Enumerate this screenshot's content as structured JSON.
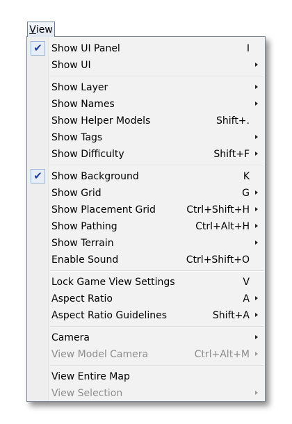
{
  "menu_bar": {
    "mnemonic": "V",
    "rest": "iew"
  },
  "groups": [
    [
      {
        "label": "Show UI Panel",
        "shortcut": "I",
        "checked": true,
        "submenu": false,
        "disabled": false
      },
      {
        "label": "Show UI",
        "shortcut": "",
        "checked": false,
        "submenu": true,
        "disabled": false
      }
    ],
    [
      {
        "label": "Show Layer",
        "shortcut": "",
        "checked": false,
        "submenu": true,
        "disabled": false
      },
      {
        "label": "Show Names",
        "shortcut": "",
        "checked": false,
        "submenu": true,
        "disabled": false
      },
      {
        "label": "Show Helper Models",
        "shortcut": "Shift+.",
        "checked": false,
        "submenu": false,
        "disabled": false
      },
      {
        "label": "Show Tags",
        "shortcut": "",
        "checked": false,
        "submenu": true,
        "disabled": false
      },
      {
        "label": "Show Difficulty",
        "shortcut": "Shift+F",
        "checked": false,
        "submenu": true,
        "disabled": false
      }
    ],
    [
      {
        "label": "Show Background",
        "shortcut": "K",
        "checked": true,
        "submenu": false,
        "disabled": false
      },
      {
        "label": "Show Grid",
        "shortcut": "G",
        "checked": false,
        "submenu": true,
        "disabled": false
      },
      {
        "label": "Show Placement Grid",
        "shortcut": "Ctrl+Shift+H",
        "checked": false,
        "submenu": true,
        "disabled": false
      },
      {
        "label": "Show Pathing",
        "shortcut": "Ctrl+Alt+H",
        "checked": false,
        "submenu": true,
        "disabled": false
      },
      {
        "label": "Show Terrain",
        "shortcut": "",
        "checked": false,
        "submenu": true,
        "disabled": false
      },
      {
        "label": "Enable Sound",
        "shortcut": "Ctrl+Shift+O",
        "checked": false,
        "submenu": false,
        "disabled": false
      }
    ],
    [
      {
        "label": "Lock Game View Settings",
        "shortcut": "V",
        "checked": false,
        "submenu": false,
        "disabled": false
      },
      {
        "label": "Aspect Ratio",
        "shortcut": "A",
        "checked": false,
        "submenu": true,
        "disabled": false
      },
      {
        "label": "Aspect Ratio Guidelines",
        "shortcut": "Shift+A",
        "checked": false,
        "submenu": true,
        "disabled": false
      }
    ],
    [
      {
        "label": "Camera",
        "shortcut": "",
        "checked": false,
        "submenu": true,
        "disabled": false
      },
      {
        "label": "View Model Camera",
        "shortcut": "Ctrl+Alt+M",
        "checked": false,
        "submenu": true,
        "disabled": true
      }
    ],
    [
      {
        "label": "View Entire Map",
        "shortcut": "",
        "checked": false,
        "submenu": false,
        "disabled": false
      },
      {
        "label": "View Selection",
        "shortcut": "",
        "checked": false,
        "submenu": true,
        "disabled": true
      }
    ]
  ],
  "icons": {
    "check": "checkmark-icon",
    "submenu": "submenu-arrow-icon"
  },
  "colors": {
    "menu_bg": "#f2f2f2",
    "check_color": "#1d3f9a",
    "disabled_text": "#8d8d8d"
  }
}
